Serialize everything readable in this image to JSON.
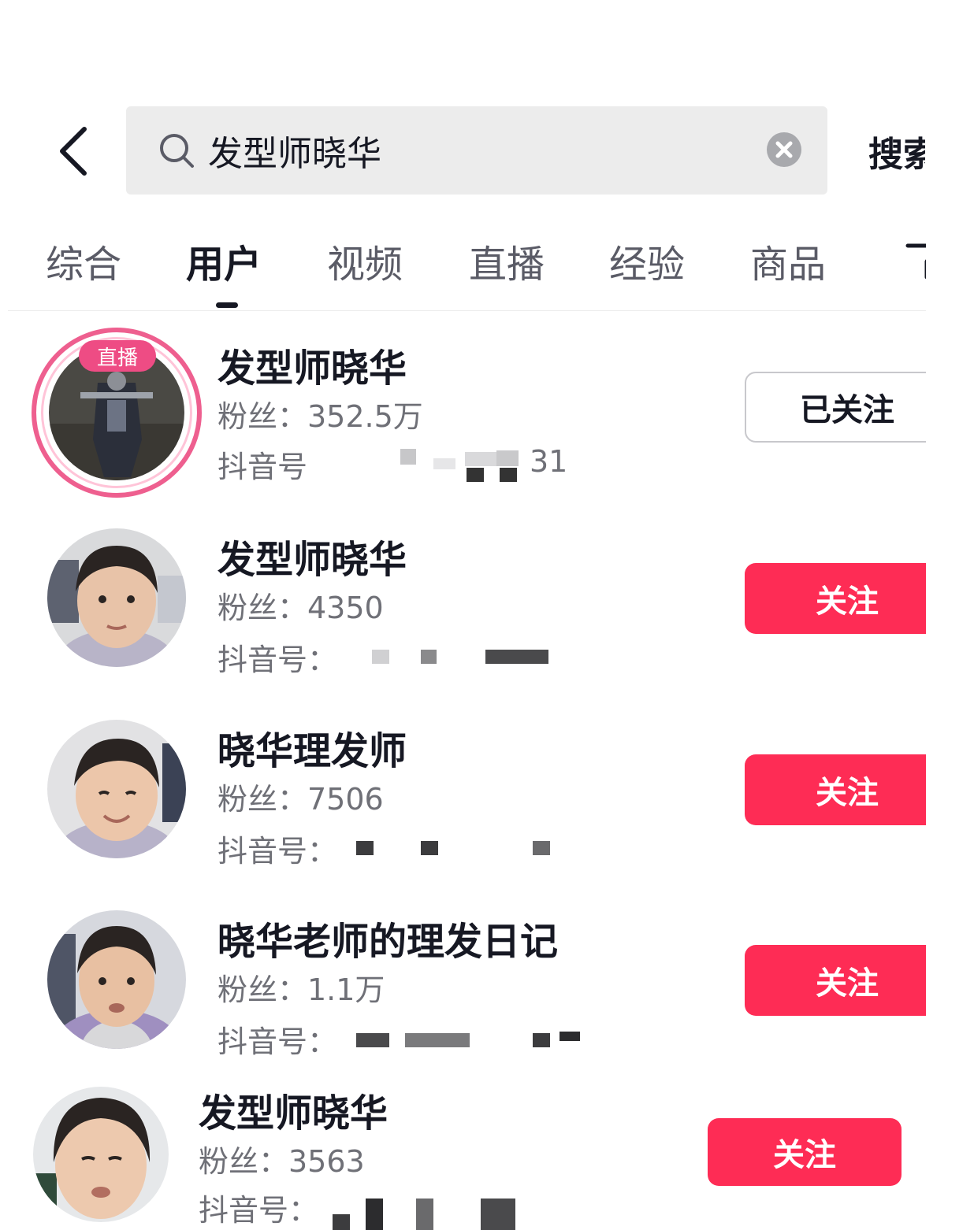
{
  "search": {
    "query": "发型师晓华",
    "search_button_label": "搜索"
  },
  "tabs": [
    {
      "label": "综合",
      "active": false
    },
    {
      "label": "用户",
      "active": true
    },
    {
      "label": "视频",
      "active": false
    },
    {
      "label": "直播",
      "active": false
    },
    {
      "label": "经验",
      "active": false
    },
    {
      "label": "商品",
      "active": false
    }
  ],
  "results": [
    {
      "name": "发型师晓华",
      "fans": "粉丝：352.5万",
      "id_label": "抖音号",
      "id_visible_tail": "31",
      "live_badge": "直播",
      "button_label": "已关注",
      "following": true
    },
    {
      "name": "发型师晓华",
      "fans": "粉丝：4350",
      "id_label": "抖音号：",
      "button_label": "关注",
      "following": false
    },
    {
      "name": "晓华理发师",
      "fans": "粉丝：7506",
      "id_label": "抖音号：",
      "button_label": "关注",
      "following": false
    },
    {
      "name": "晓华老师的理发日记",
      "fans": "粉丝：1.1万",
      "id_label": "抖音号：",
      "button_label": "关注",
      "following": false
    },
    {
      "name": "发型师晓华",
      "fans": "粉丝：3563",
      "id_label": "抖音号：",
      "button_label": "关注",
      "following": false
    }
  ],
  "colors": {
    "accent": "#fe2c55",
    "live_ring": "#ee5f8f",
    "search_bg": "#ececec"
  },
  "icons": {
    "back": "chevron-left-icon",
    "search": "search-icon",
    "clear": "clear-icon",
    "filter": "filter-icon"
  }
}
